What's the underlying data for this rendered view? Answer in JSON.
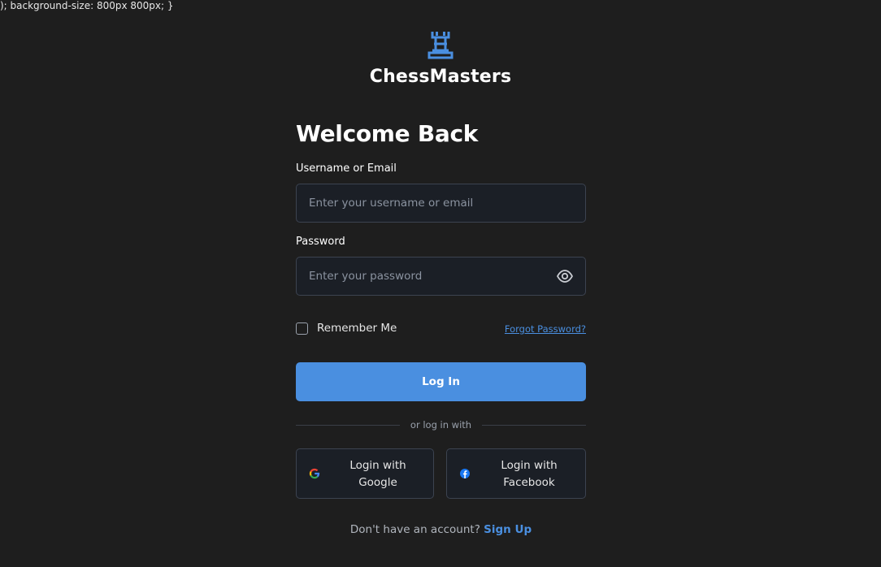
{
  "stray_text": "); background-size: 800px 800px; }",
  "brand": {
    "name": "ChessMasters",
    "icon": "chess-rook-icon",
    "color": "#4a8fe0"
  },
  "form": {
    "title": "Welcome Back",
    "username": {
      "label": "Username or Email",
      "placeholder": "Enter your username or email",
      "value": ""
    },
    "password": {
      "label": "Password",
      "placeholder": "Enter your password",
      "value": "",
      "toggle_icon": "eye-icon"
    },
    "remember_label": "Remember Me",
    "remember_checked": false,
    "forgot_label": "Forgot Password?",
    "login_label": "Log In",
    "divider_text": "or log in with",
    "social": {
      "google_line1": "Login with",
      "google_line2": "Google",
      "google_icon": "google-icon",
      "facebook_line1": "Login with",
      "facebook_line2": "Facebook",
      "facebook_icon": "facebook-icon"
    },
    "signup_prompt": "Don't have an account?",
    "signup_label": "Sign Up"
  },
  "colors": {
    "background": "#1e1e1e",
    "accent": "#4a8fe0",
    "field_bg": "#1b1f26",
    "field_border": "#3c4350"
  }
}
